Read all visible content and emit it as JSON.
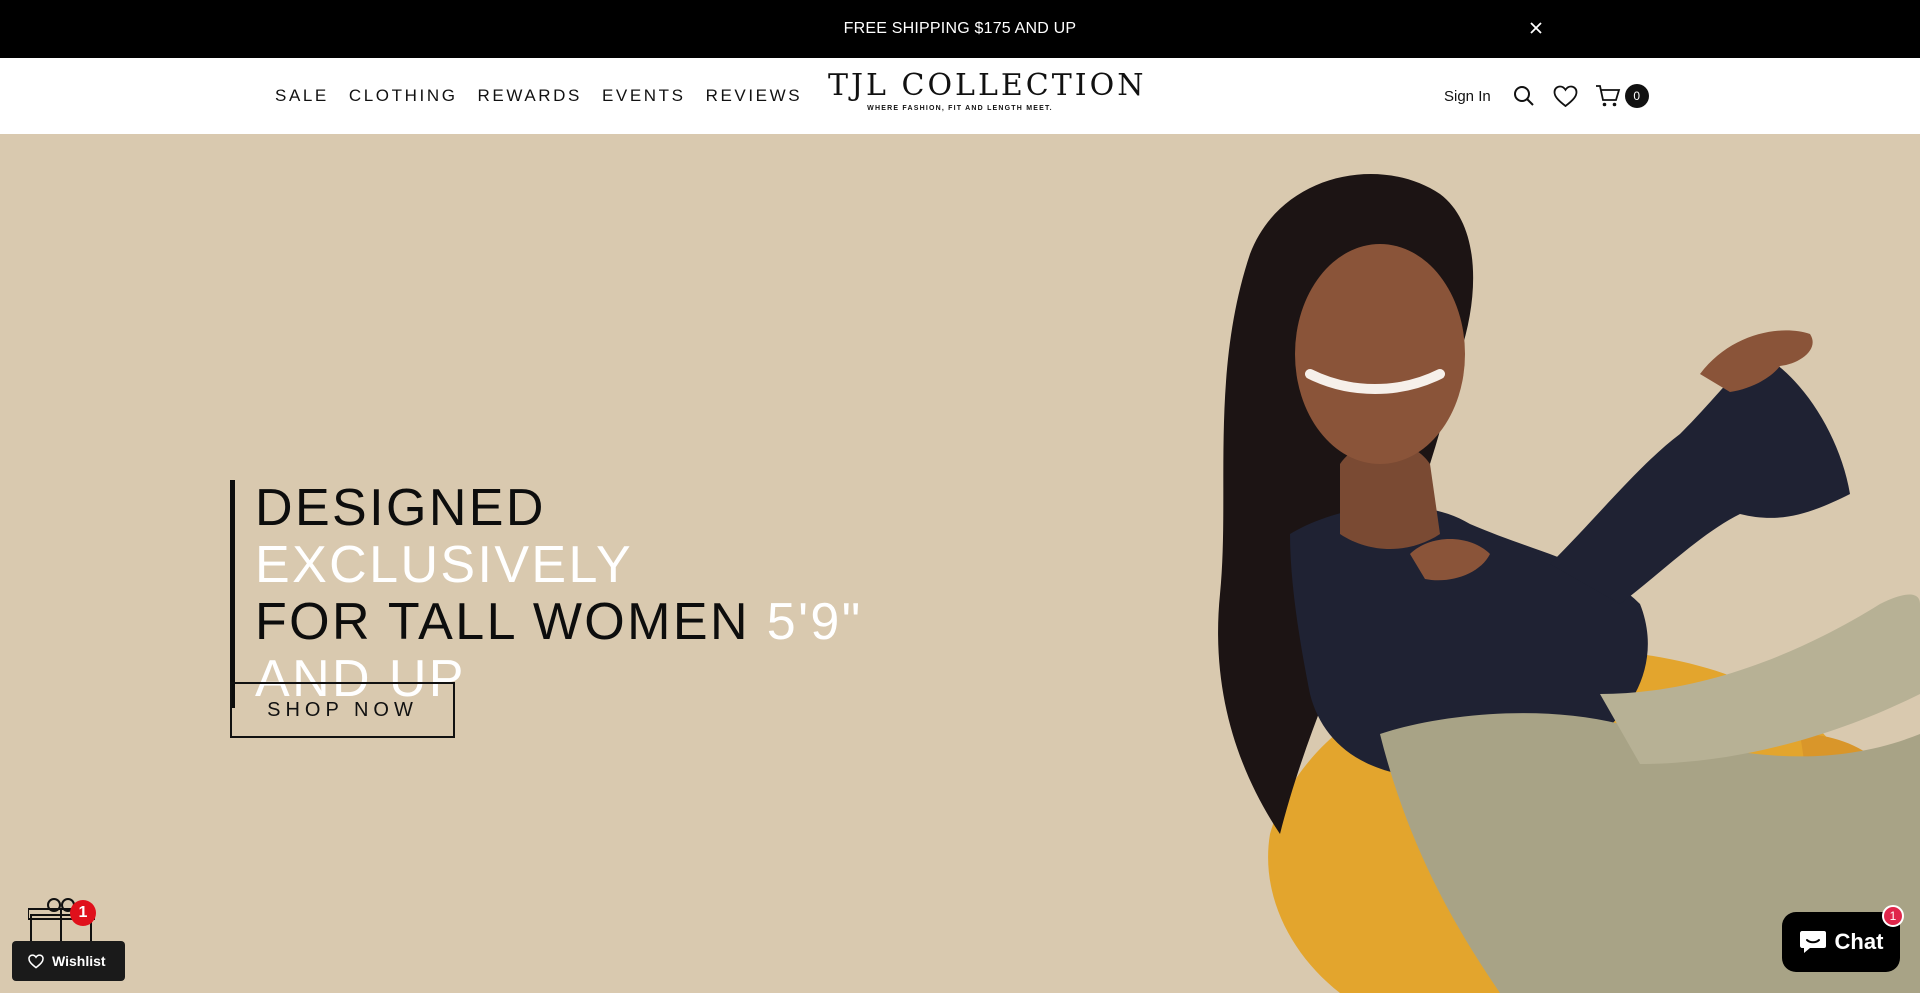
{
  "announcement": {
    "text": "FREE SHIPPING $175 AND UP",
    "close_icon": "close-icon"
  },
  "nav": {
    "items": [
      {
        "label": "SALE"
      },
      {
        "label": "CLOTHING"
      },
      {
        "label": "REWARDS"
      },
      {
        "label": "EVENTS"
      },
      {
        "label": "REVIEWS"
      }
    ]
  },
  "logo": {
    "wordmark": "TJL COLLECTION",
    "tagline": "WHERE FASHION, FIT AND LENGTH MEET."
  },
  "header_actions": {
    "sign_in": "Sign In",
    "search_icon": "search-icon",
    "wishlist_icon": "heart-icon",
    "cart_icon": "cart-icon",
    "cart_count": "0"
  },
  "hero": {
    "headline_parts": [
      {
        "text": "DESIGNED ",
        "color": "dark"
      },
      {
        "text": "EXCLUSIVELY",
        "color": "white"
      },
      {
        "text": "FOR TALL WOMEN ",
        "color": "dark"
      },
      {
        "text": "5'9\"",
        "color": "white"
      },
      {
        "text": "AND UP",
        "color": "white"
      }
    ],
    "cta": "SHOP NOW",
    "background": "#d9c9af"
  },
  "widgets": {
    "gift_badge": "1",
    "wishlist_label": "Wishlist",
    "chat_label": "Chat",
    "chat_badge": "1"
  }
}
